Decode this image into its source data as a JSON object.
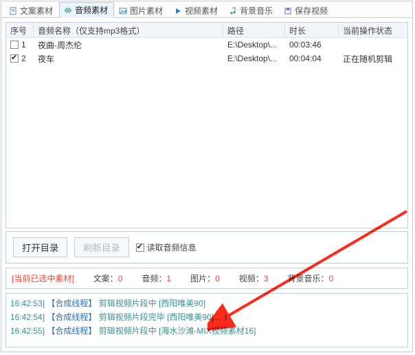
{
  "tabs": {
    "text": {
      "label": "文案素材"
    },
    "audio": {
      "label": "音频素材"
    },
    "image": {
      "label": "图片素材"
    },
    "video": {
      "label": "视频素材"
    },
    "bgm": {
      "label": "背景音乐"
    },
    "save": {
      "label": "保存视频"
    }
  },
  "columns": {
    "index": "序号",
    "name": "音频名称（仅支持mp3格式）",
    "path": "路径",
    "dur": "时长",
    "status": "当前操作状态"
  },
  "rows": [
    {
      "checked": false,
      "idx": "1",
      "name": "夜曲-周杰伦",
      "path": "E:\\Desktop\\...",
      "dur": "00:03:46",
      "status": ""
    },
    {
      "checked": true,
      "idx": "2",
      "name": "夜车",
      "path": "E:\\Desktop\\...",
      "dur": "00:04:04",
      "status": "正在随机剪辑"
    }
  ],
  "toolbar": {
    "open_dir": "打开目录",
    "refresh": "刷新目录",
    "read_audio": "读取音频信息"
  },
  "status": {
    "label": "[当前已选中素材]",
    "text": {
      "label": "文案：",
      "value": "0"
    },
    "audio": {
      "label": "音频：",
      "value": "1"
    },
    "image": {
      "label": "图片：",
      "value": "0"
    },
    "video": {
      "label": "视频：",
      "value": "3"
    },
    "bgm": {
      "label": "背景音乐：",
      "value": "0"
    }
  },
  "log": {
    "l1": {
      "time": "16:42:53]",
      "thread": "【合成线程】",
      "msg": "剪辑视频片段中 [西阳唯美90]"
    },
    "l2": {
      "time": "16:42:54]",
      "thread": "【合成线程】",
      "msg": "剪辑视频片段完毕 [西阳唯美90]..."
    },
    "l3": {
      "time": "16:42:55]",
      "thread": "【合成线程】",
      "msg": "剪辑视频片段中 [海水沙滩-MIX视频素材16]"
    }
  }
}
